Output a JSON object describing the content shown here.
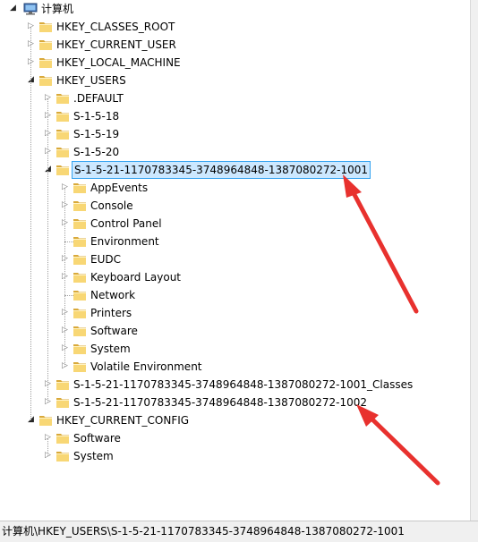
{
  "tree": {
    "root_label": "计算机",
    "nodes": [
      {
        "label": "HKEY_CLASSES_ROOT",
        "level": 1,
        "state": "collapsed"
      },
      {
        "label": "HKEY_CURRENT_USER",
        "level": 1,
        "state": "collapsed"
      },
      {
        "label": "HKEY_LOCAL_MACHINE",
        "level": 1,
        "state": "collapsed"
      },
      {
        "label": "HKEY_USERS",
        "level": 1,
        "state": "expanded"
      },
      {
        "label": ".DEFAULT",
        "level": 2,
        "state": "collapsed"
      },
      {
        "label": "S-1-5-18",
        "level": 2,
        "state": "collapsed"
      },
      {
        "label": "S-1-5-19",
        "level": 2,
        "state": "collapsed"
      },
      {
        "label": "S-1-5-20",
        "level": 2,
        "state": "collapsed"
      },
      {
        "label": "S-1-5-21-1170783345-3748964848-1387080272-1001",
        "level": 2,
        "state": "expanded",
        "selected": true
      },
      {
        "label": "AppEvents",
        "level": 3,
        "state": "collapsed"
      },
      {
        "label": "Console",
        "level": 3,
        "state": "collapsed"
      },
      {
        "label": "Control Panel",
        "level": 3,
        "state": "collapsed"
      },
      {
        "label": "Environment",
        "level": 3,
        "state": "leaf"
      },
      {
        "label": "EUDC",
        "level": 3,
        "state": "collapsed"
      },
      {
        "label": "Keyboard Layout",
        "level": 3,
        "state": "collapsed"
      },
      {
        "label": "Network",
        "level": 3,
        "state": "leaf"
      },
      {
        "label": "Printers",
        "level": 3,
        "state": "collapsed"
      },
      {
        "label": "Software",
        "level": 3,
        "state": "collapsed"
      },
      {
        "label": "System",
        "level": 3,
        "state": "collapsed"
      },
      {
        "label": "Volatile Environment",
        "level": 3,
        "state": "collapsed"
      },
      {
        "label": "S-1-5-21-1170783345-3748964848-1387080272-1001_Classes",
        "level": 2,
        "state": "collapsed"
      },
      {
        "label": "S-1-5-21-1170783345-3748964848-1387080272-1002",
        "level": 2,
        "state": "collapsed"
      },
      {
        "label": "HKEY_CURRENT_CONFIG",
        "level": 1,
        "state": "expanded"
      },
      {
        "label": "Software",
        "level": 2,
        "state": "collapsed"
      },
      {
        "label": "System",
        "level": 2,
        "state": "collapsed"
      }
    ]
  },
  "statusbar": {
    "path": "计算机\\HKEY_USERS\\S-1-5-21-1170783345-3748964848-1387080272-1001"
  },
  "icons": {
    "root": "computer-icon",
    "node": "folder-icon",
    "expander_collapsed": "chevron-right-icon",
    "expander_expanded": "chevron-down-icon",
    "annotation": "red-arrow"
  },
  "colors": {
    "selection_fill": "#cce8ff",
    "selection_border": "#33a2f0",
    "folder_fill": "#f8d775",
    "folder_dark": "#d9a93a",
    "arrow": "#e8312e"
  }
}
